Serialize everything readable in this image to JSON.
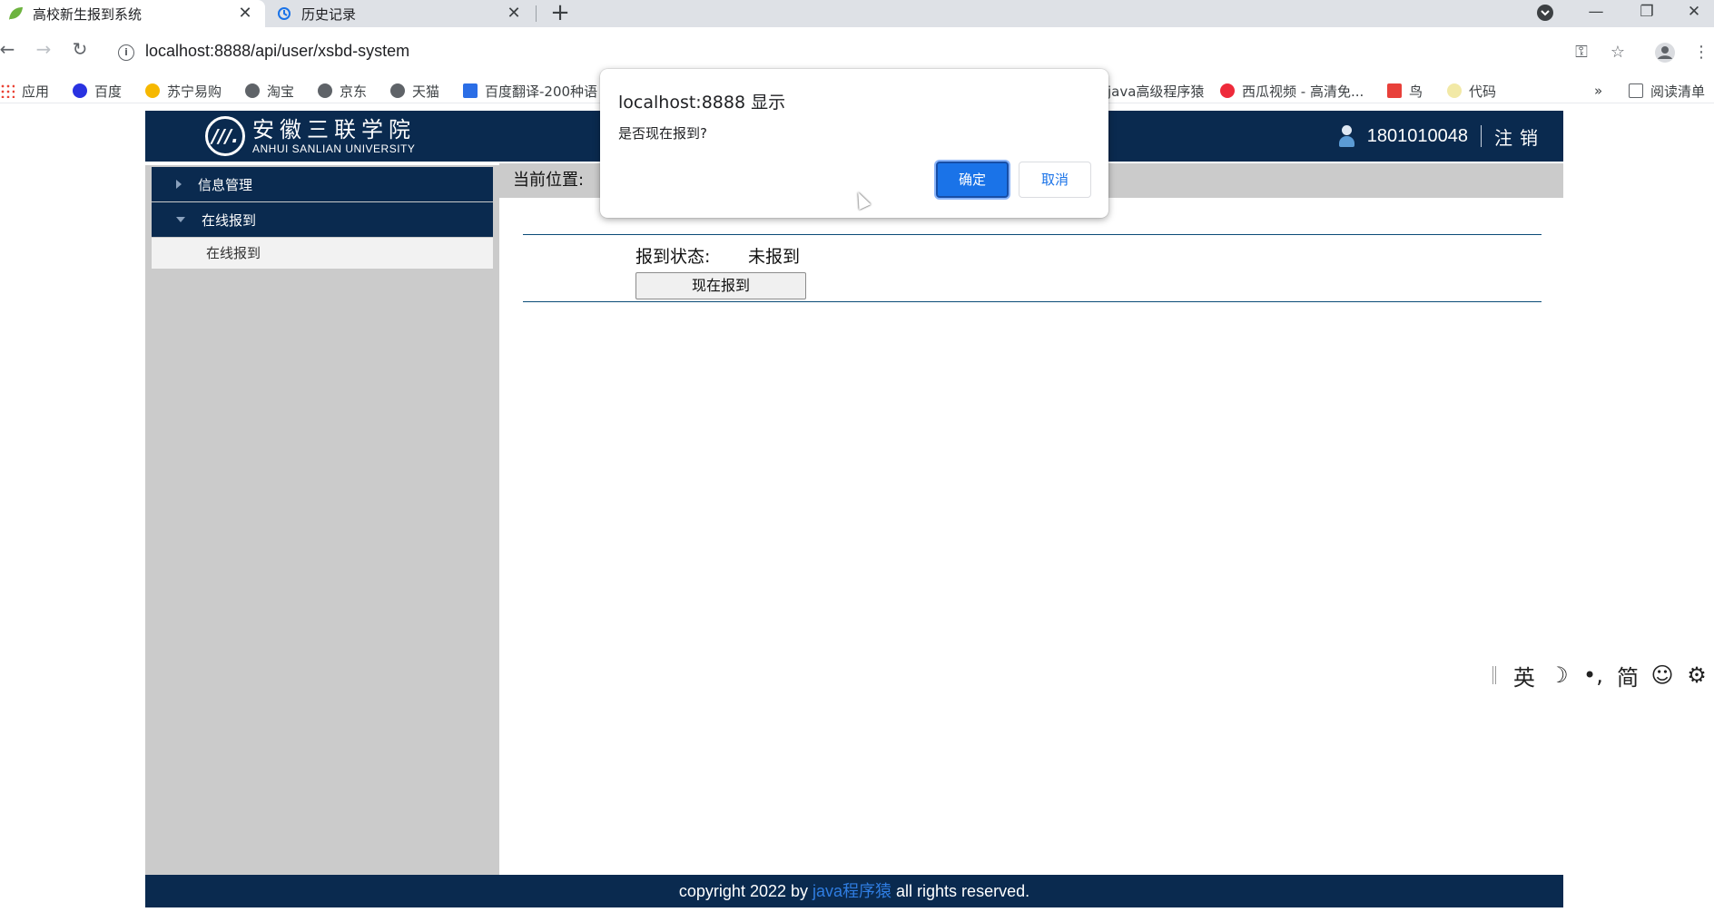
{
  "browser": {
    "tabs": [
      {
        "title": "高校新生报到系统",
        "icon": "leaf-icon",
        "active": true
      },
      {
        "title": "历史记录",
        "icon": "history-icon",
        "active": false
      }
    ],
    "url": "localhost:8888/api/user/xsbd-system",
    "bookmarks": [
      {
        "label": "应用",
        "icon": "apps-grid-icon"
      },
      {
        "label": "百度",
        "icon": "baidu-paw-icon"
      },
      {
        "label": "苏宁易购",
        "icon": "suning-icon"
      },
      {
        "label": "淘宝",
        "icon": "globe-icon"
      },
      {
        "label": "京东",
        "icon": "globe-icon"
      },
      {
        "label": "天猫",
        "icon": "globe-icon"
      },
      {
        "label": "百度翻译-200种语",
        "icon": "translate-icon"
      },
      {
        "label": "java高级程序猿",
        "icon": "none"
      },
      {
        "label": "西瓜视频 - 高清免...",
        "icon": "xigua-icon"
      },
      {
        "label": "鸟",
        "icon": "bird-icon"
      },
      {
        "label": "代码",
        "icon": "code-icon"
      }
    ],
    "overflow_label": "»",
    "reading_list_label": "阅读清单"
  },
  "header": {
    "logo_cn": "安徽三联学院",
    "logo_en": "ANHUI SANLIAN UNIVERSITY",
    "user_id": "1801010048",
    "logout_label": "注销"
  },
  "sidebar": {
    "groups": [
      {
        "label": "信息管理",
        "expanded": false
      },
      {
        "label": "在线报到",
        "expanded": true,
        "items": [
          {
            "label": "在线报到"
          }
        ]
      }
    ]
  },
  "main": {
    "breadcrumb_label": "当前位置:",
    "status_label": "报到状态:",
    "status_value": "未报到",
    "report_button": "现在报到"
  },
  "footer": {
    "prefix": "copyright 2022 by ",
    "author": "java程序猿",
    "suffix": " all rights reserved."
  },
  "ime": {
    "items": [
      "英",
      "☽",
      "•,",
      "简",
      "☺",
      "⚙"
    ]
  },
  "dialog": {
    "title": "localhost:8888 显示",
    "message": "是否现在报到?",
    "ok_label": "确定",
    "cancel_label": "取消"
  },
  "colors": {
    "navy": "#0a2a4f",
    "sidebar_gray": "#cbcbcb",
    "primary_blue": "#1a73e8",
    "footer_link": "#2f7de1"
  }
}
